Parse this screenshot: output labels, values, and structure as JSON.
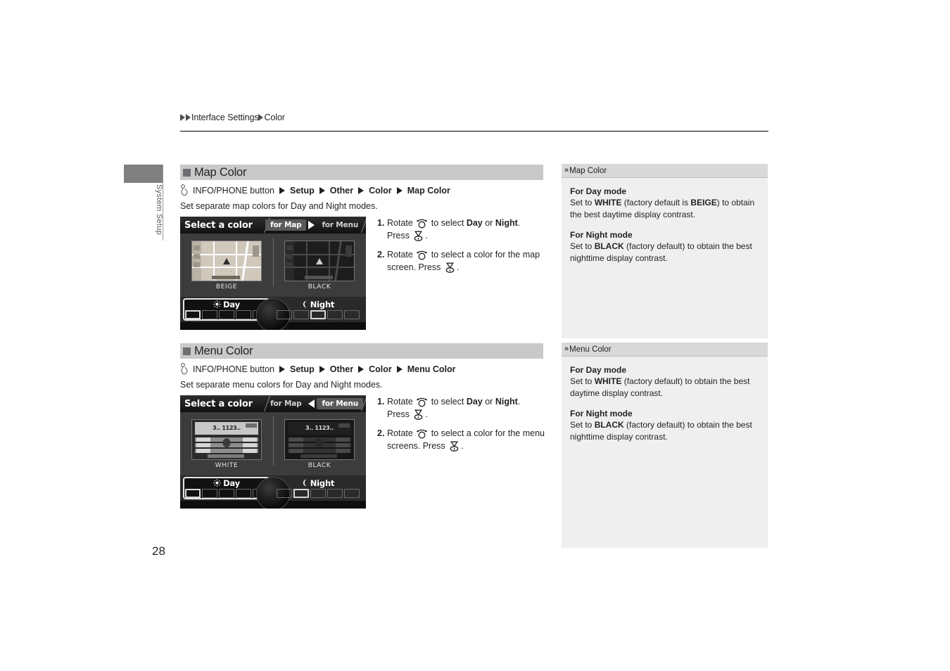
{
  "breadcrumb": {
    "parent": "Interface Settings",
    "current": "Color"
  },
  "side_tab": {
    "label": "System Setup"
  },
  "page_number": "28",
  "sections": [
    {
      "title": "Map Color",
      "nav_path": {
        "button": "INFO/PHONE button",
        "steps": [
          "Setup",
          "Other",
          "Color",
          "Map Color"
        ]
      },
      "description": "Set separate map colors for Day and Night modes.",
      "device": {
        "title": "Select a color",
        "tab_map": "for Map",
        "tab_menu": "for Menu",
        "active_tab": "for Map",
        "arrow_direction": "right",
        "left_preview_label": "BEIGE",
        "right_preview_label": "BLACK",
        "preview_kind": "map",
        "day_label": "Day",
        "night_label": "Night",
        "day_icon": "sun-icon",
        "night_icon": "moon-icon",
        "selected_panel": "Day",
        "day_swatch_count": 5,
        "day_current_index": 0,
        "night_swatch_count": 5,
        "night_current_index": 2
      },
      "steps": [
        {
          "num": "1.",
          "parts": [
            {
              "t": "Rotate ",
              "s": "n"
            },
            {
              "t": "rotate-knob-icon",
              "s": "icon-rotate"
            },
            {
              "t": " to select ",
              "s": "n"
            },
            {
              "t": "Day",
              "s": "b"
            },
            {
              "t": " or ",
              "s": "n"
            },
            {
              "t": "Night",
              "s": "b"
            },
            {
              "t": ". Press ",
              "s": "n"
            },
            {
              "t": "press-knob-icon",
              "s": "icon-press"
            },
            {
              "t": ".",
              "s": "n"
            }
          ]
        },
        {
          "num": "2.",
          "parts": [
            {
              "t": "Rotate ",
              "s": "n"
            },
            {
              "t": "rotate-knob-icon",
              "s": "icon-rotate"
            },
            {
              "t": " to select a color for the map screen. Press ",
              "s": "n"
            },
            {
              "t": "press-knob-icon",
              "s": "icon-press"
            },
            {
              "t": ".",
              "s": "n"
            }
          ]
        }
      ]
    },
    {
      "title": "Menu Color",
      "nav_path": {
        "button": "INFO/PHONE button",
        "steps": [
          "Setup",
          "Other",
          "Color",
          "Menu Color"
        ]
      },
      "description": "Set separate menu colors for Day and Night modes.",
      "device": {
        "title": "Select a color",
        "tab_map": "for Map",
        "tab_menu": "for Menu",
        "active_tab": "for Menu",
        "arrow_direction": "left",
        "left_preview_label": "WHITE",
        "right_preview_label": "BLACK",
        "preview_kind": "menu",
        "preview_freq": "3.. 1123..",
        "day_label": "Day",
        "night_label": "Night",
        "day_icon": "sun-icon",
        "night_icon": "moon-icon",
        "selected_panel": "Day",
        "day_swatch_count": 5,
        "day_current_index": 0,
        "night_swatch_count": 5,
        "night_current_index": 1
      },
      "steps": [
        {
          "num": "1.",
          "parts": [
            {
              "t": "Rotate ",
              "s": "n"
            },
            {
              "t": "rotate-knob-icon",
              "s": "icon-rotate"
            },
            {
              "t": " to select ",
              "s": "n"
            },
            {
              "t": "Day",
              "s": "b"
            },
            {
              "t": " or ",
              "s": "n"
            },
            {
              "t": "Night",
              "s": "b"
            },
            {
              "t": ". Press ",
              "s": "n"
            },
            {
              "t": "press-knob-icon",
              "s": "icon-press"
            },
            {
              "t": ".",
              "s": "n"
            }
          ]
        },
        {
          "num": "2.",
          "parts": [
            {
              "t": "Rotate ",
              "s": "n"
            },
            {
              "t": "rotate-knob-icon",
              "s": "icon-rotate"
            },
            {
              "t": " to select a color for the menu screens. Press ",
              "s": "n"
            },
            {
              "t": "press-knob-icon",
              "s": "icon-press"
            },
            {
              "t": ".",
              "s": "n"
            }
          ]
        }
      ]
    }
  ],
  "notes": [
    {
      "title": "Map Color",
      "blocks": [
        {
          "heading": "For Day mode",
          "parts": [
            {
              "t": "Set to ",
              "s": "n"
            },
            {
              "t": "WHITE",
              "s": "b"
            },
            {
              "t": " (factory default is ",
              "s": "n"
            },
            {
              "t": "BEIGE",
              "s": "b"
            },
            {
              "t": ") to obtain the best daytime display contrast.",
              "s": "n"
            }
          ]
        },
        {
          "heading": "For Night mode",
          "parts": [
            {
              "t": "Set to ",
              "s": "n"
            },
            {
              "t": "BLACK",
              "s": "b"
            },
            {
              "t": " (factory default) to obtain the best nighttime display contrast.",
              "s": "n"
            }
          ]
        }
      ]
    },
    {
      "title": "Menu Color",
      "blocks": [
        {
          "heading": "For Day mode",
          "parts": [
            {
              "t": "Set to ",
              "s": "n"
            },
            {
              "t": "WHITE",
              "s": "b"
            },
            {
              "t": " (factory default) to obtain the best daytime display contrast.",
              "s": "n"
            }
          ]
        },
        {
          "heading": "For Night mode",
          "parts": [
            {
              "t": "Set to ",
              "s": "n"
            },
            {
              "t": "BLACK",
              "s": "b"
            },
            {
              "t": " (factory default) to obtain the best nighttime display contrast.",
              "s": "n"
            }
          ]
        }
      ]
    }
  ]
}
